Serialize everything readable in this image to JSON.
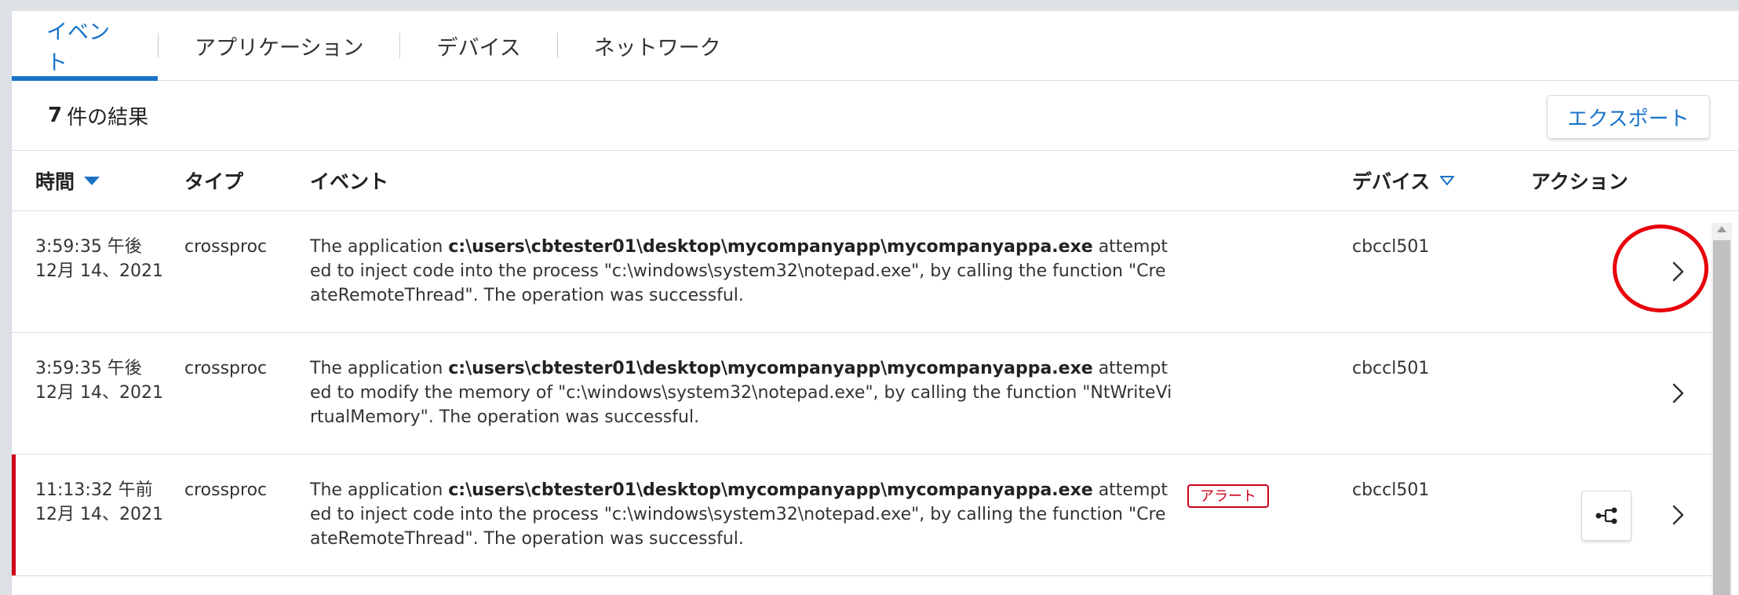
{
  "tabs": [
    {
      "label": "イベント",
      "active": true
    },
    {
      "label": "アプリケーション",
      "active": false
    },
    {
      "label": "デバイス",
      "active": false
    },
    {
      "label": "ネットワーク",
      "active": false
    }
  ],
  "results": {
    "count": "7",
    "suffix": "件の結果"
  },
  "export_label": "エクスポート",
  "columns": {
    "time": "時間",
    "type": "タイプ",
    "event": "イベント",
    "device": "デバイス",
    "action": "アクション"
  },
  "rows": [
    {
      "time": "3:59:35 午後",
      "date": "12月 14、2021",
      "type": "crossproc",
      "event_prefix": "The application ",
      "event_path": "c:\\users\\cbtester01\\desktop\\mycompanyapp\\mycompanyappa.exe",
      "event_suffix": " attempted to inject code into the process \"c:\\windows\\system32\\notepad.exe\", by calling the function \"CreateRemoteThread\". The operation was successful.",
      "device": "cbccl501"
    },
    {
      "time": "3:59:35 午後",
      "date": "12月 14、2021",
      "type": "crossproc",
      "event_prefix": "The application ",
      "event_path": "c:\\users\\cbtester01\\desktop\\mycompanyapp\\mycompanyappa.exe",
      "event_suffix": " attempted to modify the memory of \"c:\\windows\\system32\\notepad.exe\", by calling the function \"NtWriteVirtualMemory\". The operation was successful.",
      "device": "cbccl501"
    },
    {
      "time": "11:13:32 午前",
      "date": "12月 14、2021",
      "type": "crossproc",
      "event_prefix": "The application ",
      "event_path": "c:\\users\\cbtester01\\desktop\\mycompanyapp\\mycompanyappa.exe",
      "event_suffix": " attempted to inject code into the process \"c:\\windows\\system32\\notepad.exe\", by calling the function \"CreateRemoteThread\". The operation was successful.",
      "device": "cbccl501",
      "badge": "アラート"
    }
  ],
  "colors": {
    "accent": "#1a73c9",
    "alert": "#d0021b",
    "annotation": "#e8000b"
  },
  "icons": {
    "sort": "caret-down-icon",
    "detail": "chevron-right-icon",
    "graph": "process-tree-icon"
  }
}
